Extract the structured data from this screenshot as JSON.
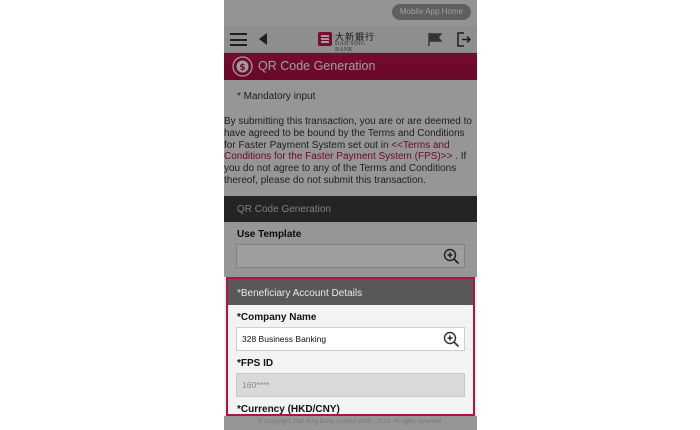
{
  "top": {
    "mobile_home": "Mobile App Home"
  },
  "nav": {
    "logo_chinese": "大新銀行",
    "logo_english": "DAH SING BANK"
  },
  "header": {
    "title": "QR Code Generation"
  },
  "notice": {
    "mandatory": "* Mandatory input",
    "terms_prefix": "By submitting this transaction, you are or are deemed to have agreed to be bound by the Terms and Conditions for Faster Payment System set out in ",
    "terms_link": "<<Terms and Conditions for the Faster Payment System (FPS)>>",
    "terms_suffix": " . If you do not agree to any of the Terms and Conditions thereof, please do not submit this transaction."
  },
  "qr_section": {
    "title": "QR Code Generation",
    "use_template_label": "Use Template",
    "use_template_value": ""
  },
  "beneficiary": {
    "title": "*Beneficiary Account Details",
    "company_name_label": "*Company Name",
    "company_name_value": "328 Business Banking",
    "fps_id_label": "*FPS ID",
    "fps_id_value": "160****",
    "currency_label": "*Currency (HKD/CNY)"
  },
  "footer": {
    "copyright": "© Copyright. Dah Sing Bank, Limited 2000 - 2019. All rights reserved."
  },
  "colors": {
    "brand": "#b0103f",
    "section_dark": "#3a3a3a",
    "panel_header": "#585858"
  },
  "icons": [
    "menu-icon",
    "back-arrow-icon",
    "bank-logo-icon",
    "flag-icon",
    "logout-icon",
    "qr-dollar-icon",
    "zoom-in-icon"
  ]
}
